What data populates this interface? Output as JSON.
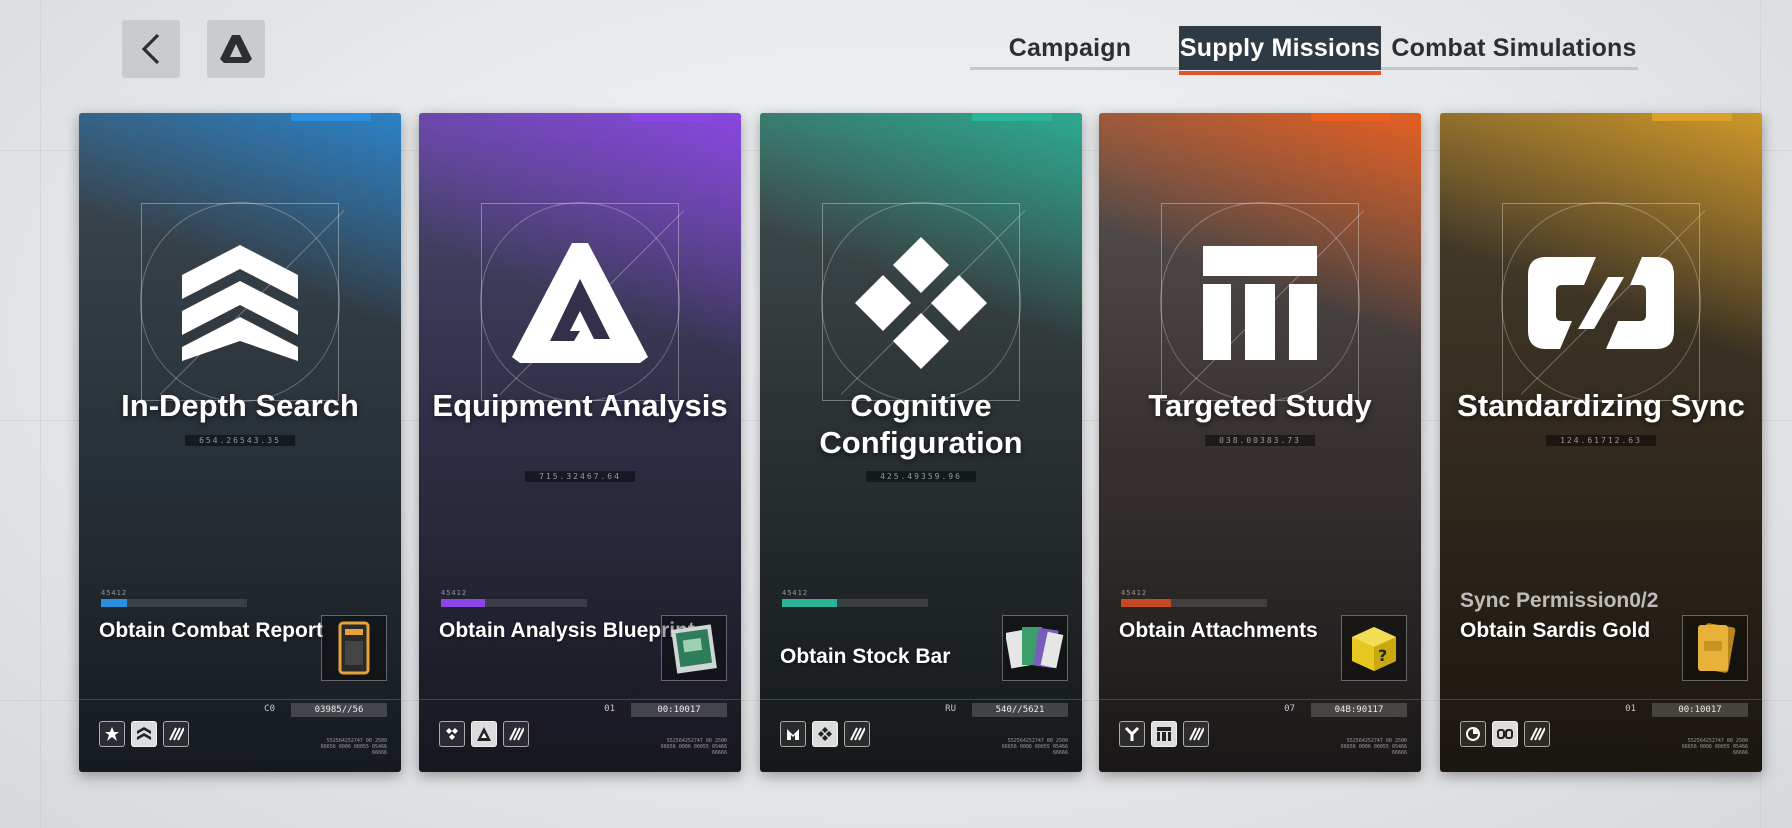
{
  "header": {
    "back_icon": "chevron-left-icon",
    "logo_icon": "triangle-logo-icon"
  },
  "tabs": [
    {
      "label": "Campaign",
      "active": false
    },
    {
      "label": "Supply Missions",
      "active": true
    },
    {
      "label": "Combat Simulations",
      "active": false
    }
  ],
  "colors": {
    "active_tab_bg": "#2e3b44",
    "active_tab_underline": "#e0542a",
    "card1_accent": "#2b8fde",
    "card2_accent": "#8c46e6",
    "card3_accent": "#2bb496",
    "card4_accent": "#eb5f1e",
    "card5_accent": "#dca028"
  },
  "cards": [
    {
      "title": "In-Depth Search",
      "code": "654.26543.35",
      "small_id": "45412",
      "permission": "",
      "reward": "Obtain Combat Report",
      "item_icon": "combat-report-icon",
      "footer_label": "C0",
      "footer_code": "03985//56",
      "emblem_icon": "chevron-stack-icon",
      "fine_print": "552564252747 00 2500 66656 0006 00055 05466 66666"
    },
    {
      "title": "Equipment Analysis",
      "code": "715.32467.64",
      "small_id": "45412",
      "permission": "",
      "reward": "Obtain Analysis Blueprint",
      "item_icon": "blueprint-icon",
      "footer_label": "01",
      "footer_code": "00:10017",
      "emblem_icon": "triangle-emblem-icon",
      "fine_print": "552564252747 00 2500 66656 0006 00055 05466 66666"
    },
    {
      "title": "Cognitive Configuration",
      "code": "425.49359.96",
      "small_id": "45412",
      "permission": "",
      "reward": "Obtain Stock Bar",
      "item_icon": "stock-bar-icon",
      "footer_label": "RU",
      "footer_code": "540//5621",
      "emblem_icon": "diamond-cluster-icon",
      "fine_print": "552564252747 00 2500 66656 0006 00055 05466 66666"
    },
    {
      "title": "Targeted Study",
      "code": "038.00383.73",
      "small_id": "45412",
      "permission": "",
      "reward": "Obtain Attachments",
      "item_icon": "attachment-box-icon",
      "footer_label": "07",
      "footer_code": "04B:90117",
      "emblem_icon": "iti-block-icon",
      "fine_print": "552564252747 00 2500 66656 0006 00055 05466 66666"
    },
    {
      "title": "Standardizing Sync",
      "code": "124.61712.63",
      "small_id": "",
      "permission": "Sync Permission0/2",
      "reward": "Obtain Sardis Gold",
      "item_icon": "gold-bar-icon",
      "footer_label": "01",
      "footer_code": "00:10017",
      "emblem_icon": "link-chain-icon",
      "fine_print": "552564252747 00 2500 66656 0006 00055 05466 66666"
    }
  ]
}
